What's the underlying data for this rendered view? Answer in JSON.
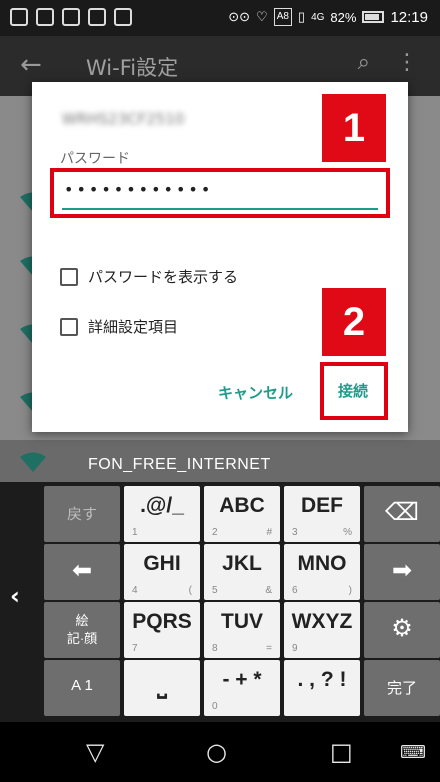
{
  "status_bar": {
    "battery": "82%",
    "time": "12:19",
    "badge": "A8",
    "signal_text": "4G"
  },
  "app_bar": {
    "title": "Wi-Fi設定"
  },
  "dialog": {
    "ssid": "WRHS23CF2510",
    "password_label": "パスワード",
    "password_value": "••••••••••••",
    "show_password_label": "パスワードを表示する",
    "advanced_label": "詳細設定項目",
    "cancel_label": "キャンセル",
    "connect_label": "接続",
    "callout_1": "1",
    "callout_2": "2"
  },
  "background_network": "FON_FREE_INTERNET",
  "keyboard": {
    "row1": {
      "back": "戻す",
      "k1_main": ".@/_",
      "k1_num": "1",
      "k2_main": "ABC",
      "k2_num": "2",
      "k2_sym": "#",
      "k3_main": "DEF",
      "k3_num": "3",
      "k3_sym": "%"
    },
    "row2": {
      "k4_main": "GHI",
      "k4_num": "4",
      "k4_sym": "(",
      "k5_main": "JKL",
      "k5_num": "5",
      "k5_sym": "&",
      "k6_main": "MNO",
      "k6_num": "6",
      "k6_sym": ")"
    },
    "row3": {
      "emoji_line1": "絵",
      "emoji_line2": "記·顔",
      "k7_main": "PQRS",
      "k7_num": "7",
      "k8_main": "TUV",
      "k8_num": "8",
      "k8_sym": "=",
      "k9_main": "WXYZ",
      "k9_num": "9"
    },
    "row4": {
      "mode": "A 1",
      "k0_main": "- + *",
      "k0_num": "0",
      "kpunct_main": ". , ? !",
      "done": "完了"
    }
  },
  "colors": {
    "accent": "#1d9c8c",
    "highlight_red": "#e00012"
  }
}
